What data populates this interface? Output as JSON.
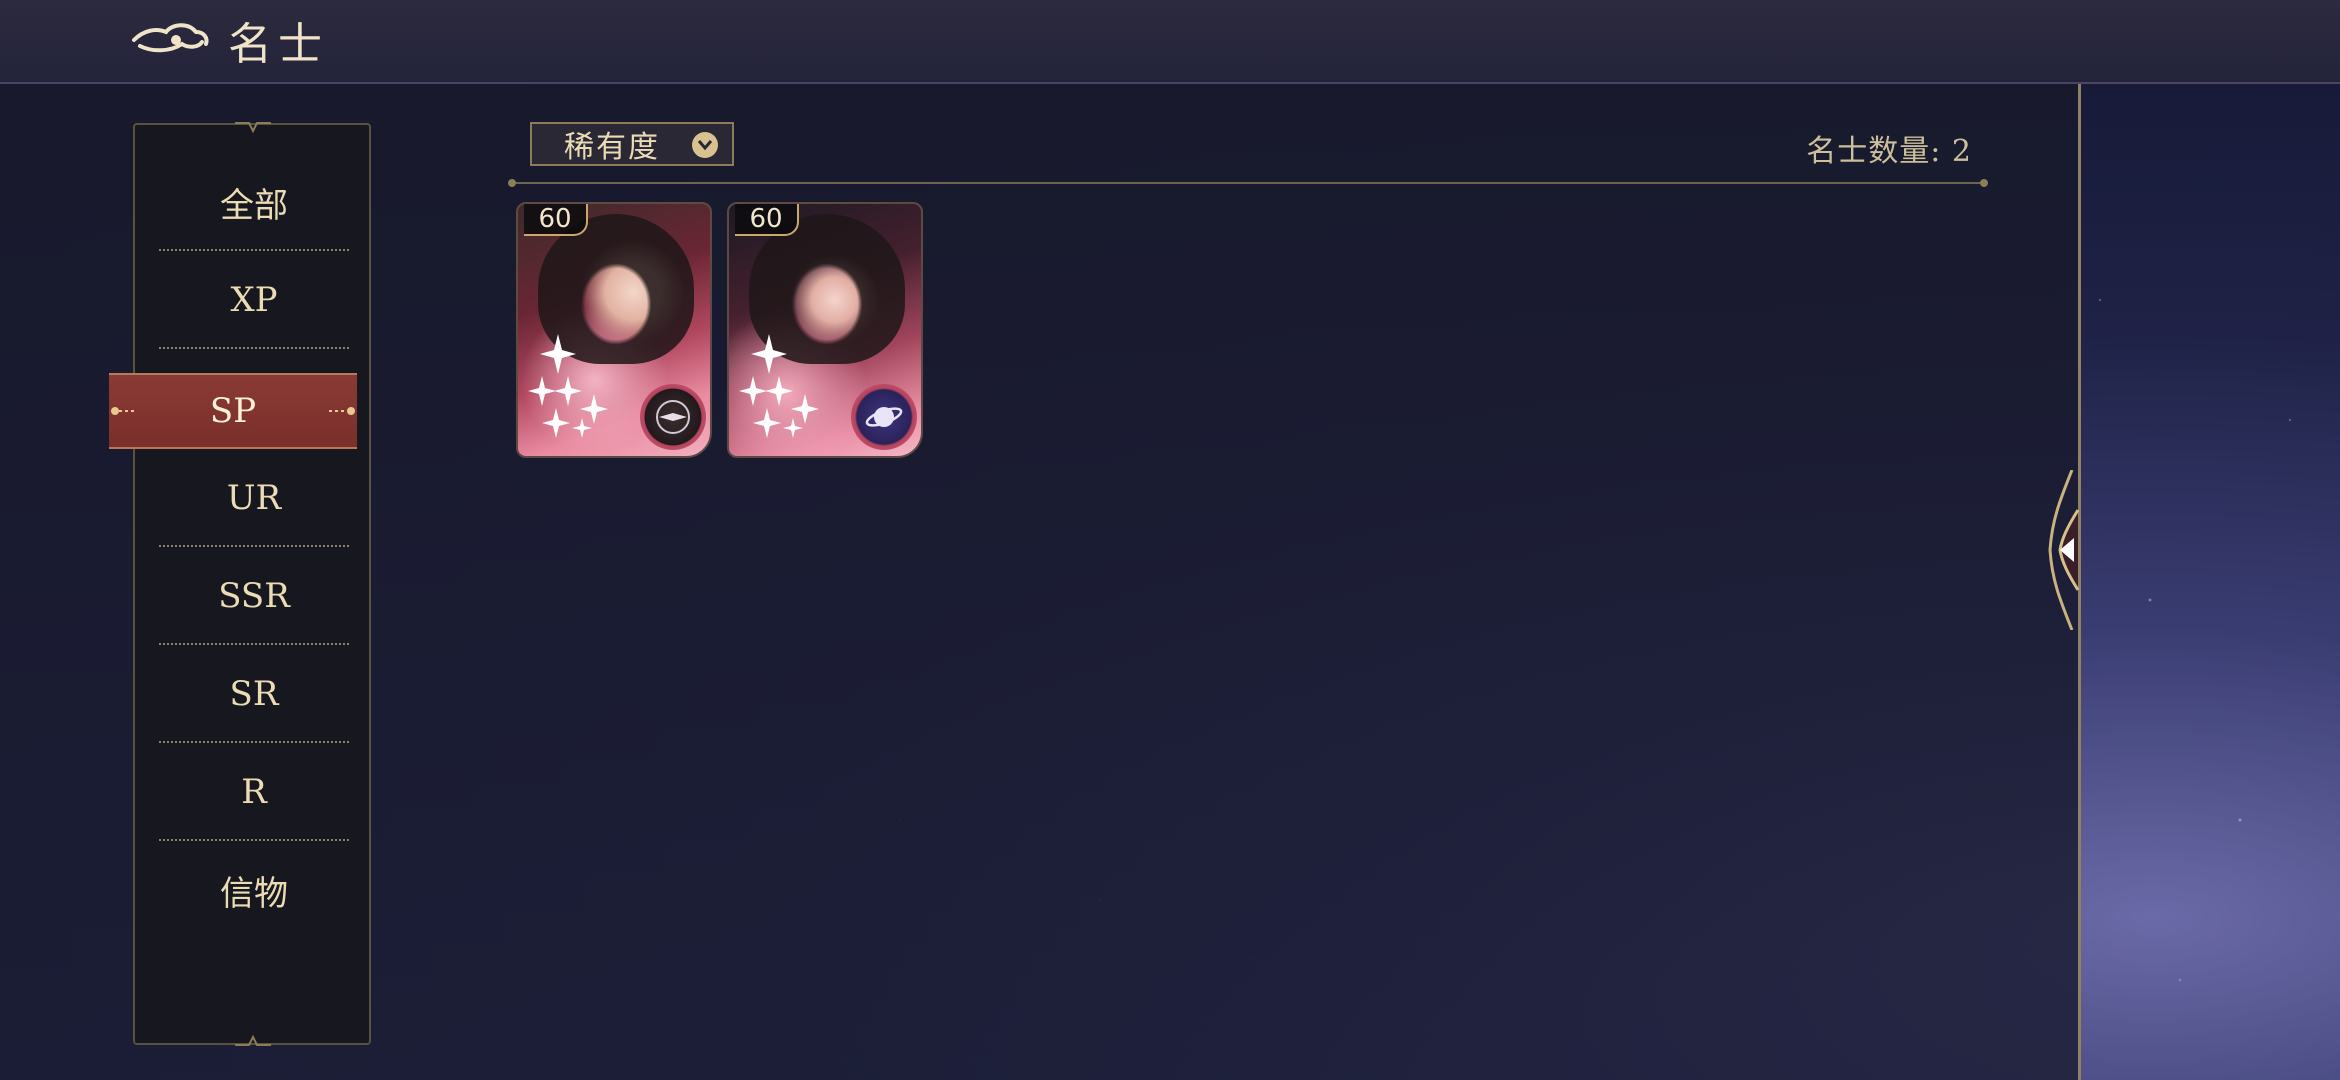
{
  "header": {
    "title": "名士"
  },
  "sidebar": {
    "items": [
      {
        "label": "全部"
      },
      {
        "label": "XP"
      },
      {
        "label": "SP",
        "active": true
      },
      {
        "label": "UR"
      },
      {
        "label": "SSR"
      },
      {
        "label": "SR"
      },
      {
        "label": "R"
      },
      {
        "label": "信物"
      }
    ]
  },
  "filter": {
    "label": "稀有度"
  },
  "count": {
    "text": "名士数量: 2"
  },
  "cards": [
    {
      "level": "60",
      "stars": 6,
      "badge_icon": "compass-icon"
    },
    {
      "level": "60",
      "stars": 6,
      "badge_icon": "planet-icon"
    }
  ],
  "colors": {
    "accent_gold": "#ecdcb5",
    "active_red": "#8a3a34",
    "panel_border": "#8f8263"
  }
}
